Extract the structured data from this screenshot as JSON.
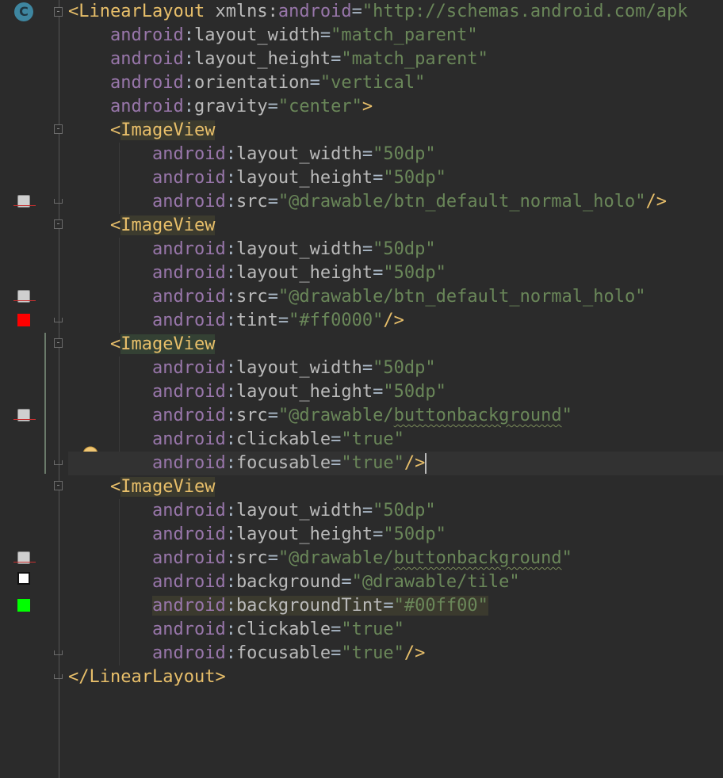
{
  "gutter": {
    "class_badge": "C",
    "icons": [
      "class-c-icon",
      "fold-icon",
      "image-preview-icon",
      "color-swatch-icon",
      "lightbulb-icon"
    ]
  },
  "colors": {
    "tint_swatch": "#ff0000",
    "background_tint_swatch": "#00ff00",
    "tile_swatch": "#ffffff"
  },
  "code": {
    "l1": {
      "open": "<",
      "tag": "LinearLayout",
      "ns": " xmlns:",
      "ns2": "android",
      "eq": "=",
      "val": "\"http://schemas.android.com/apk"
    },
    "l2": {
      "ns": "android",
      "colon": ":",
      "attr": "layout_width",
      "eq": "=",
      "val": "\"match_parent\""
    },
    "l3": {
      "ns": "android",
      "colon": ":",
      "attr": "layout_height",
      "eq": "=",
      "val": "\"match_parent\""
    },
    "l4": {
      "ns": "android",
      "colon": ":",
      "attr": "orientation",
      "eq": "=",
      "val": "\"vertical\""
    },
    "l5": {
      "ns": "android",
      "colon": ":",
      "attr": "gravity",
      "eq": "=",
      "val": "\"center\"",
      "close": ">"
    },
    "l6": {
      "open": "<",
      "tag": "ImageView"
    },
    "l7": {
      "ns": "android",
      "colon": ":",
      "attr": "layout_width",
      "eq": "=",
      "val": "\"50dp\""
    },
    "l8": {
      "ns": "android",
      "colon": ":",
      "attr": "layout_height",
      "eq": "=",
      "val": "\"50dp\""
    },
    "l9": {
      "ns": "android",
      "colon": ":",
      "attr": "src",
      "eq": "=",
      "val": "\"@drawable/btn_default_normal_holo\"",
      "close": "/>"
    },
    "l10": {
      "open": "<",
      "tag": "ImageView"
    },
    "l11": {
      "ns": "android",
      "colon": ":",
      "attr": "layout_width",
      "eq": "=",
      "val": "\"50dp\""
    },
    "l12": {
      "ns": "android",
      "colon": ":",
      "attr": "layout_height",
      "eq": "=",
      "val": "\"50dp\""
    },
    "l13": {
      "ns": "android",
      "colon": ":",
      "attr": "src",
      "eq": "=",
      "val": "\"@drawable/btn_default_normal_holo\""
    },
    "l14": {
      "ns": "android",
      "colon": ":",
      "attr": "tint",
      "eq": "=",
      "val": "\"#ff0000\"",
      "close": "/>"
    },
    "l15": {
      "open": "<",
      "tag": "ImageView"
    },
    "l16": {
      "ns": "android",
      "colon": ":",
      "attr": "layout_width",
      "eq": "=",
      "val": "\"50dp\""
    },
    "l17": {
      "ns": "android",
      "colon": ":",
      "attr": "layout_height",
      "eq": "=",
      "val": "\"50dp\""
    },
    "l18": {
      "ns": "android",
      "colon": ":",
      "attr": "src",
      "eq": "=",
      "val_a": "\"@drawable/",
      "val_b": "buttonbackground",
      "val_c": "\""
    },
    "l19": {
      "ns": "android",
      "colon": ":",
      "attr": "clickable",
      "eq": "=",
      "val": "\"true\""
    },
    "l20": {
      "ns": "android",
      "colon": ":",
      "attr": "focusable",
      "eq": "=",
      "val": "\"true\"",
      "close": "/>"
    },
    "l21": {
      "open": "<",
      "tag": "ImageView"
    },
    "l22": {
      "ns": "android",
      "colon": ":",
      "attr": "layout_width",
      "eq": "=",
      "val": "\"50dp\""
    },
    "l23": {
      "ns": "android",
      "colon": ":",
      "attr": "layout_height",
      "eq": "=",
      "val": "\"50dp\""
    },
    "l24": {
      "ns": "android",
      "colon": ":",
      "attr": "src",
      "eq": "=",
      "val_a": "\"@drawable/",
      "val_b": "buttonbackground",
      "val_c": "\""
    },
    "l25": {
      "ns": "android",
      "colon": ":",
      "attr": "background",
      "eq": "=",
      "val": "\"@drawable/tile\""
    },
    "l26": {
      "ns": "android",
      "colon": ":",
      "attr": "backgroundTint",
      "eq": "=",
      "val": "\"#00ff00\""
    },
    "l27": {
      "ns": "android",
      "colon": ":",
      "attr": "clickable",
      "eq": "=",
      "val": "\"true\""
    },
    "l28": {
      "ns": "android",
      "colon": ":",
      "attr": "focusable",
      "eq": "=",
      "val": "\"true\"",
      "close": "/>"
    },
    "l29": {
      "open": "</",
      "tag": "LinearLayout",
      "close": ">"
    }
  }
}
